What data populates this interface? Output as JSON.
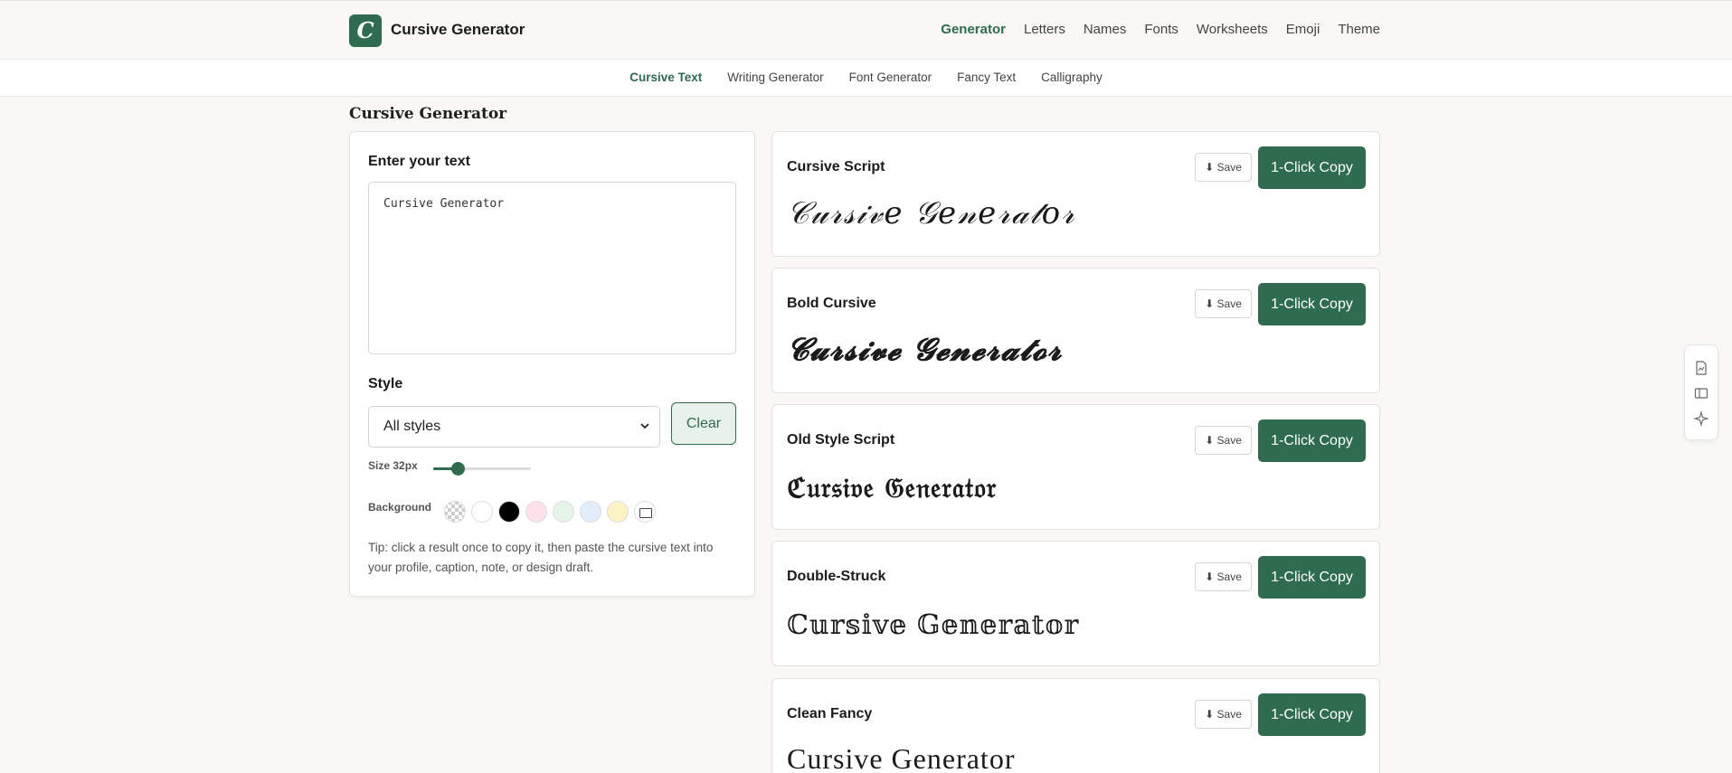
{
  "header": {
    "logo_letter": "C",
    "brand": "Cursive Generator",
    "nav": [
      "Generator",
      "Letters",
      "Names",
      "Fonts",
      "Worksheets",
      "Emoji",
      "Theme"
    ]
  },
  "subnav": [
    "Cursive Text",
    "Writing Generator",
    "Font Generator",
    "Fancy Text",
    "Calligraphy"
  ],
  "page_title": "Cursive Generator",
  "input": {
    "label": "Enter your text",
    "value": "Cursive Generator"
  },
  "style": {
    "label": "Style",
    "selected": "All styles",
    "clear_label": "Clear"
  },
  "size": {
    "label": "Size 32px",
    "fraction": 0.25
  },
  "background": {
    "label": "Background",
    "swatches": [
      "transparent",
      "#ffffff",
      "#000000",
      "#fde2ec",
      "#e6f3e8",
      "#e2eefc",
      "#fcf2c3",
      "frame"
    ]
  },
  "tip": "Tip: click a result once to copy it, then paste the cursive text into your profile, caption, note, or design draft.",
  "results": [
    {
      "name": "Cursive Script",
      "save": "⬇ Save",
      "copy": "1-Click Copy",
      "preview": "𝒞𝓊𝓇𝓈𝒾𝓋𝑒 𝒢𝑒𝓃𝑒𝓇𝒶𝓉𝑜𝓇"
    },
    {
      "name": "Bold Cursive",
      "save": "⬇ Save",
      "copy": "1-Click Copy",
      "preview": "𝓒𝓾𝓻𝓼𝓲𝓿𝓮 𝓖𝓮𝓷𝓮𝓻𝓪𝓽𝓸𝓻"
    },
    {
      "name": "Old Style Script",
      "save": "⬇ Save",
      "copy": "1-Click Copy",
      "preview": "ℭ𝔲𝔯𝔰𝔦𝔳𝔢 𝔊𝔢𝔫𝔢𝔯𝔞𝔱𝔬𝔯"
    },
    {
      "name": "Double-Struck",
      "save": "⬇ Save",
      "copy": "1-Click Copy",
      "preview": "ℂ𝕦𝕣𝕤𝕚𝕧𝕖 𝔾𝕖𝕟𝕖𝕣𝕒𝕥𝕠𝕣"
    },
    {
      "name": "Clean Fancy",
      "save": "⬇ Save",
      "copy": "1-Click Copy",
      "preview": "Cursive Generator"
    }
  ],
  "colors": {
    "accent": "#2f6b4f",
    "page_bg": "#f9f8f4"
  },
  "side_tools": [
    "document-icon",
    "panel-icon",
    "sparkle-icon"
  ]
}
